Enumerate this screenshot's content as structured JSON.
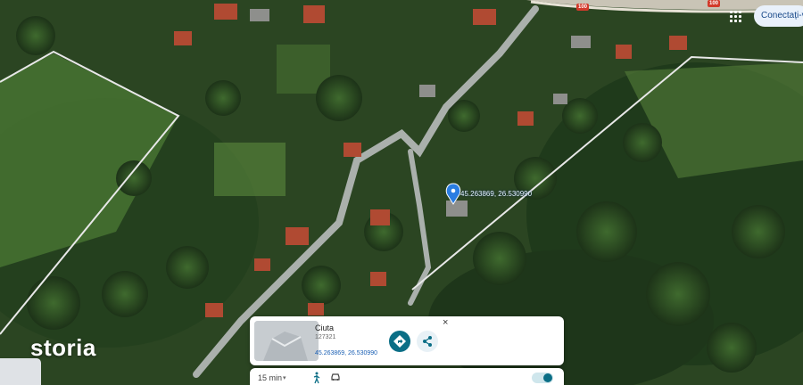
{
  "map": {
    "type": "satellite",
    "pin_coordinates_label": "45.263869, 26.530990",
    "road_tags": [
      "100",
      "100"
    ],
    "colors": {
      "road_line": "#cfd6d3",
      "boundary": "#e8e8e8",
      "pin": "#2a7de1"
    }
  },
  "header": {
    "sign_in_label": "Conectați-v",
    "apps_icon": "grid-icon"
  },
  "place_card": {
    "name": "Ciuta",
    "code": "127321",
    "coordinates": "45.263869, 26.530990",
    "close_label": "×",
    "directions_icon": "directions-icon",
    "share_icon": "share-icon"
  },
  "trip": {
    "duration": "15 min",
    "caret": "▾",
    "modes": [
      "walk-icon",
      "car-icon"
    ]
  },
  "branding": {
    "logo_text": "storia"
  }
}
